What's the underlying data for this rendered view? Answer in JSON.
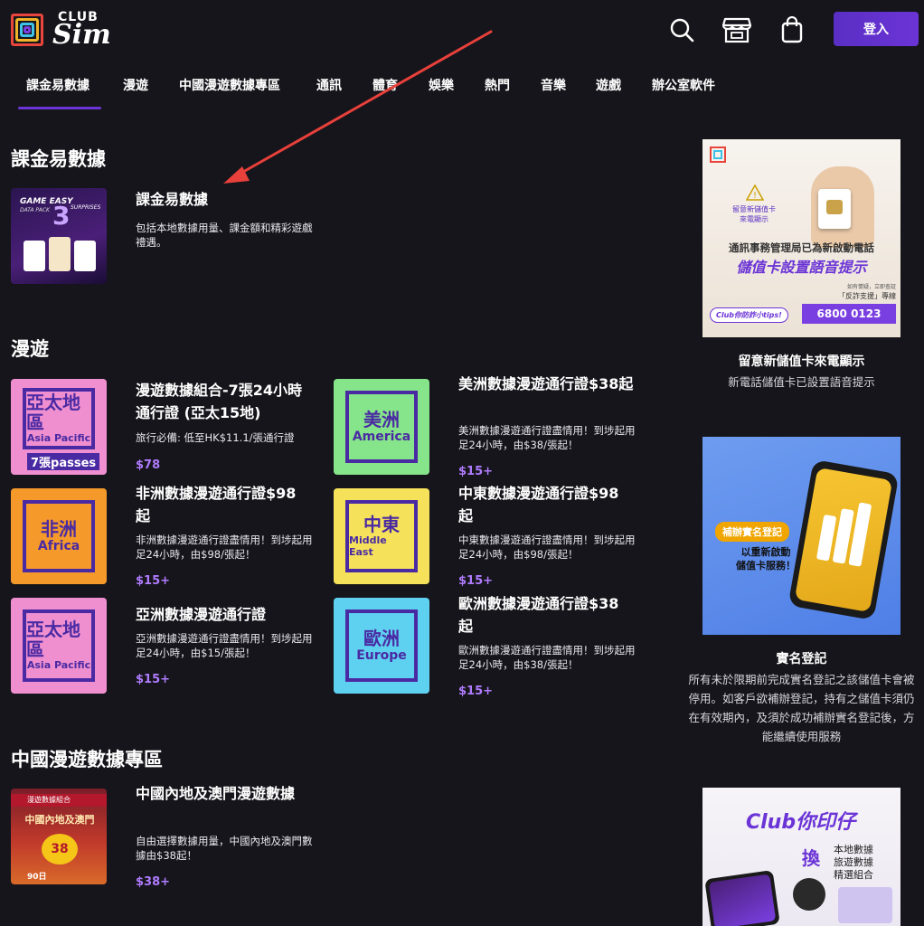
{
  "brand": {
    "club": "CLUB",
    "sim": "Sim"
  },
  "header": {
    "login_label": "登入"
  },
  "nav": [
    "課金易數據",
    "漫遊",
    "中國漫遊數據專區",
    "通訊",
    "體育",
    "娛樂",
    "熱門",
    "音樂",
    "遊戲",
    "辦公室軟件"
  ],
  "sections": {
    "gaming": {
      "title": "課金易數據"
    },
    "roaming": {
      "title": "漫遊"
    },
    "china": {
      "title": "中國漫遊數據專區"
    }
  },
  "gaming_card": {
    "title": "課金易數據",
    "desc": "包括本地數據用量、課金額和精彩遊戲禮遇。",
    "thumb_text": "GAME EASY",
    "thumb_sub": "DATA PACK",
    "thumb_num": "3",
    "thumb_sup": "SURPRISES"
  },
  "roaming_cards": [
    {
      "title": "漫遊數據組合-7張24小時通行證 (亞太15地)",
      "desc": "旅行必備: 低至HK$11.1/張通行證",
      "price": "$78",
      "zh": "亞太地區",
      "en": "Asia Pacific",
      "extra": "7張passes",
      "color": "#f08fcf"
    },
    {
      "title": "美洲數據漫遊通行證$38起",
      "desc": "美洲數據漫遊通行證盡情用！到埗起用足24小時，由$38/張起！",
      "price": "$15+",
      "zh": "美洲",
      "en": "America",
      "extra": "",
      "color": "#86e48a"
    },
    {
      "title": "非洲數據漫遊通行證$98起",
      "desc": "非洲數據漫遊通行證盡情用！到埗起用足24小時，由$98/張起！",
      "price": "$15+",
      "zh": "非洲",
      "en": "Africa",
      "extra": "",
      "color": "#f59a2a"
    },
    {
      "title": "中東數據漫遊通行證$98起",
      "desc": "中東數據漫遊通行證盡情用！到埗起用足24小時，由$98/張起！",
      "price": "$15+",
      "zh": "中東",
      "en": "Middle East",
      "extra": "",
      "color": "#f5e25a"
    },
    {
      "title": "亞洲數據漫遊通行證",
      "desc": "亞洲數據漫遊通行證盡情用！到埗起用足24小時，由$15/張起！",
      "price": "$15+",
      "zh": "亞太地區",
      "en": "Asia Pacific",
      "extra": "",
      "color": "#f08fcf"
    },
    {
      "title": "歐洲數據漫遊通行證$38起",
      "desc": "歐洲數據漫遊通行證盡情用！到埗起用足24小時，由$38/張起！",
      "price": "$15+",
      "zh": "歐洲",
      "en": "Europe",
      "extra": "",
      "color": "#5fd1f0"
    }
  ],
  "china_card": {
    "title": "中國內地及澳門漫遊數據",
    "desc": "自由選擇數據用量，中國內地及澳門數據由$38起！",
    "price": "$38+",
    "thumb_tag": "漫遊數據組合",
    "thumb_zh": "中國內地及澳門",
    "thumb_days": "90日",
    "thumb_price": "38"
  },
  "sidebar": {
    "ad1": {
      "title": "留意新儲值卡來電顯示",
      "desc": "新電話儲值卡已設置語音提示",
      "img_line1": "留意新儲值卡",
      "img_line2": "來電顯示",
      "img_main1": "通訊事務管理局已為新啟動電話",
      "img_main2": "儲值卡設置語音提示",
      "img_badge": "Club你防詐小tips!",
      "img_phone_label": "「反詐支援」專線",
      "img_phone": "6800 0123",
      "img_small": "如有懷疑，立即查証"
    },
    "ad2": {
      "title": "實名登記",
      "desc": "所有未於限期前完成實名登記之該儲值卡會被停用。如客戶欲補辦登記，持有之儲值卡須仍在有效期內，及須於成功補辦實名登記後，方能繼續使用服務",
      "img_tag": "補辦實名登記",
      "img_line1": "以重新啟動",
      "img_line2": "儲值卡服務！"
    },
    "ad3": {
      "img_title": "Club你印仔",
      "img_swap": "換",
      "img_items": [
        "本地數據",
        "旅遊數據",
        "精選組合"
      ]
    }
  },
  "colors": {
    "accent": "#6b34d6",
    "price": "#b07cff",
    "background": "#16151b"
  }
}
